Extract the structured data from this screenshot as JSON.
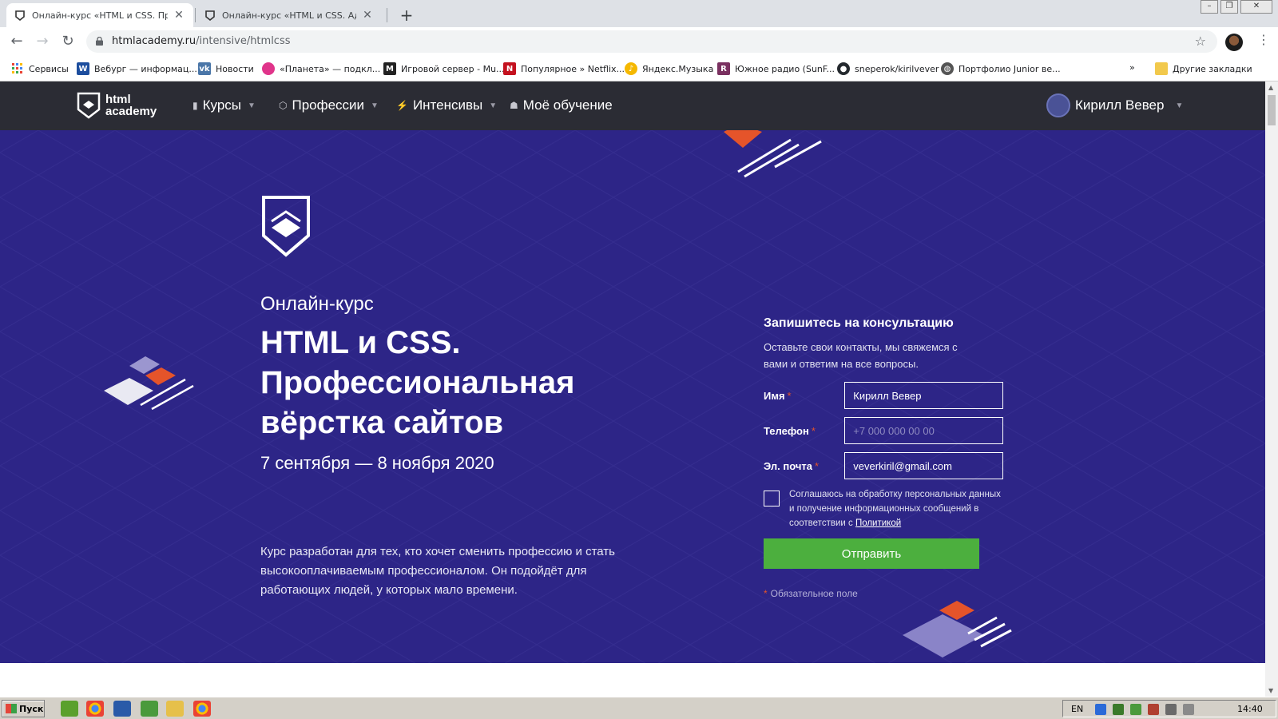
{
  "browser": {
    "tabs": [
      {
        "title": "Онлайн-курс «HTML и CSS. Профес"
      },
      {
        "title": "Онлайн-курс «HTML и CSS. Адапти"
      }
    ],
    "new_tab": "+",
    "url_host": "htmlacademy.ru",
    "url_path": "/intensive/htmlcss",
    "bookmarks": [
      {
        "label": "Сервисы",
        "icon": "apps-grid-icon"
      },
      {
        "label": "Вебург — информац...",
        "icon": "w-icon",
        "color": "#1d4e9e"
      },
      {
        "label": "Новости",
        "icon": "vk-icon",
        "color": "#4a76a8"
      },
      {
        "label": "«Планета» — подкл...",
        "icon": "planeta-icon",
        "color": "#e0348a"
      },
      {
        "label": "Игровой сервер - Mu...",
        "icon": "m-icon",
        "color": "#222222"
      },
      {
        "label": "Популярное » Netflix...",
        "icon": "netflix-icon",
        "color": "#c4121f"
      },
      {
        "label": "Яндекс.Музыка",
        "icon": "yandex-music-icon",
        "color": "#f5b800"
      },
      {
        "label": "Южное радио (SunF...",
        "icon": "radio-icon",
        "color": "#7a3060"
      },
      {
        "label": "sneperok/kirilvever",
        "icon": "github-icon",
        "color": "#24292e"
      },
      {
        "label": "Портфолио Junior ве...",
        "icon": "globe-icon",
        "color": "#555555"
      },
      {
        "label": "Другие закладки",
        "icon": "folder-icon",
        "color": "#f2c94c"
      }
    ],
    "overflow": "»"
  },
  "site": {
    "logo_line1": "html",
    "logo_line2": "academy",
    "nav": [
      {
        "label": "Курсы",
        "icon": "bars-icon",
        "glyph": "▮"
      },
      {
        "label": "Профессии",
        "icon": "hat-icon",
        "glyph": "⬡"
      },
      {
        "label": "Интенсивы",
        "icon": "lightning-icon",
        "glyph": "⚡"
      },
      {
        "label": "Моё обучение",
        "icon": "people-icon",
        "glyph": "☗"
      }
    ],
    "user_name": "Кирилл Вевер"
  },
  "hero": {
    "subtitle": "Онлайн-курс",
    "title_line1": "HTML и CSS.",
    "title_line2": "Профессиональная",
    "title_line3": "вёрстка сайтов",
    "dates": "7 сентября — 8 ноября 2020",
    "description": "Курс разработан для тех, кто хочет сменить профессию и стать высокооплачиваемым профессионалом. Он подойдёт для работающих людей, у которых мало времени."
  },
  "form": {
    "heading": "Запишитесь на консультацию",
    "lead": "Оставьте свои контакты, мы свяжемся с вами и ответим на все вопросы.",
    "name_label": "Имя",
    "name_value": "Кирилл Вевер",
    "phone_label": "Телефон",
    "phone_placeholder": "+7 000 000 00 00",
    "email_label": "Эл. почта",
    "email_value": "veverkiril@gmail.com",
    "required_mark": "*",
    "consent_text": "Соглашаюсь на обработку персональных данных и получение информационных сообщений в соответствии с ",
    "consent_link": "Политикой",
    "submit_label": "Отправить",
    "required_note": "Обязательное поле"
  },
  "taskbar": {
    "start_label": "Пуск",
    "lang": "EN",
    "time": "14:40"
  },
  "colors": {
    "hero_bg": "#2d2587",
    "header_bg": "#2b2c34",
    "accent_orange": "#e5542a",
    "submit_green": "#4caf3e"
  }
}
